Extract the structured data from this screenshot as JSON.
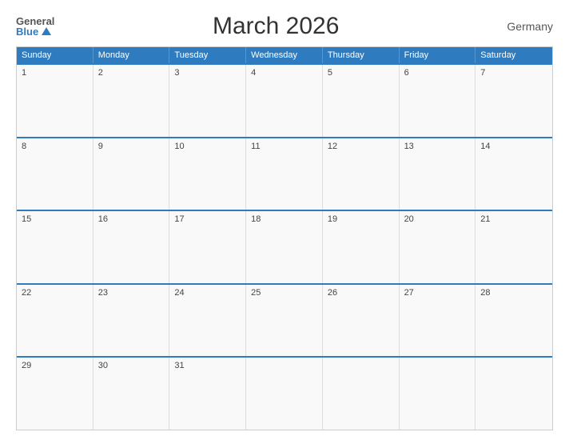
{
  "header": {
    "logo_general": "General",
    "logo_blue": "Blue",
    "title": "March 2026",
    "country": "Germany"
  },
  "calendar": {
    "days": [
      "Sunday",
      "Monday",
      "Tuesday",
      "Wednesday",
      "Thursday",
      "Friday",
      "Saturday"
    ],
    "weeks": [
      [
        {
          "day": 1
        },
        {
          "day": 2
        },
        {
          "day": 3
        },
        {
          "day": 4
        },
        {
          "day": 5
        },
        {
          "day": 6
        },
        {
          "day": 7
        }
      ],
      [
        {
          "day": 8
        },
        {
          "day": 9
        },
        {
          "day": 10
        },
        {
          "day": 11
        },
        {
          "day": 12
        },
        {
          "day": 13
        },
        {
          "day": 14
        }
      ],
      [
        {
          "day": 15
        },
        {
          "day": 16
        },
        {
          "day": 17
        },
        {
          "day": 18
        },
        {
          "day": 19
        },
        {
          "day": 20
        },
        {
          "day": 21
        }
      ],
      [
        {
          "day": 22
        },
        {
          "day": 23
        },
        {
          "day": 24
        },
        {
          "day": 25
        },
        {
          "day": 26
        },
        {
          "day": 27
        },
        {
          "day": 28
        }
      ],
      [
        {
          "day": 29
        },
        {
          "day": 30
        },
        {
          "day": 31
        },
        {
          "day": null
        },
        {
          "day": null
        },
        {
          "day": null
        },
        {
          "day": null
        }
      ]
    ]
  }
}
